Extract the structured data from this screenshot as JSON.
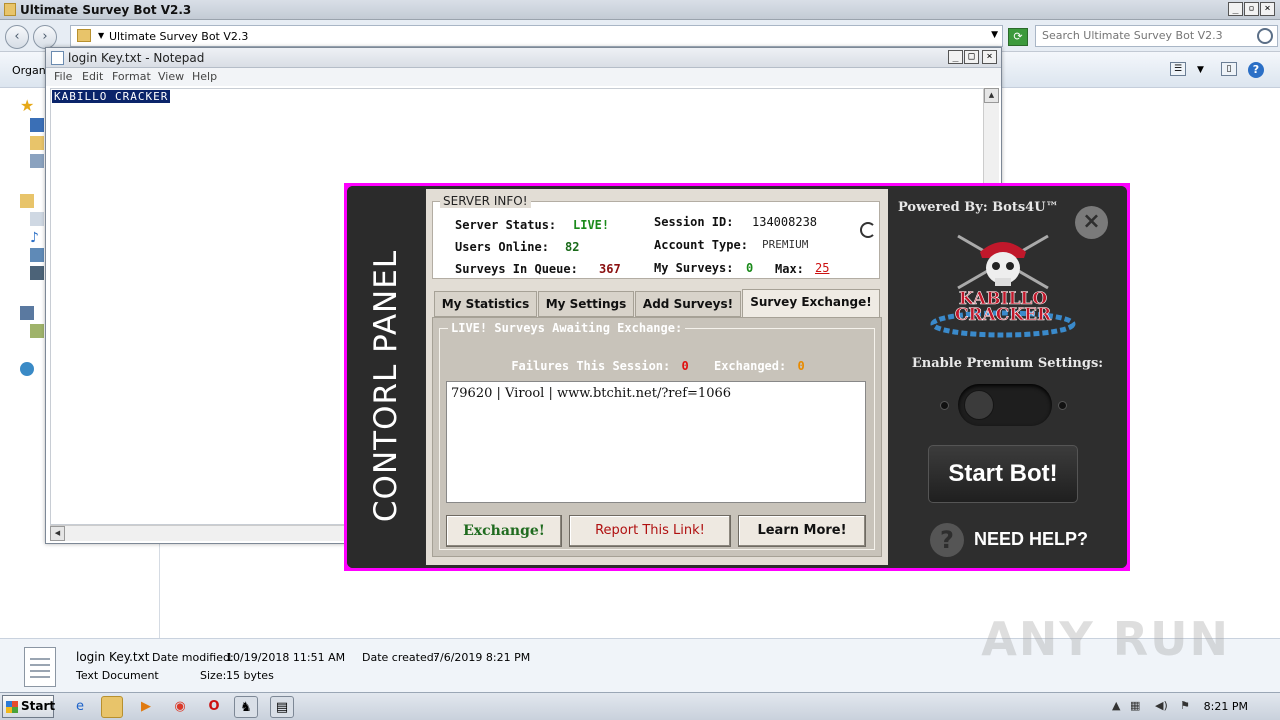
{
  "explorer": {
    "title": "Ultimate Survey Bot V2.3",
    "address": "Ultimate Survey Bot V2.3",
    "search_placeholder": "Search Ultimate Survey Bot V2.3",
    "organize_label": "Organi"
  },
  "file_details": {
    "name": "login Key.txt",
    "type": "Text Document",
    "date_modified_label": "Date modified:",
    "date_modified": "10/19/2018 11:51 AM",
    "date_created_label": "Date created:",
    "date_created": "7/6/2019 8:21 PM",
    "size_label": "Size:",
    "size": "15 bytes"
  },
  "notepad": {
    "title": "login Key.txt - Notepad",
    "menu": [
      "File",
      "Edit",
      "Format",
      "View",
      "Help"
    ],
    "content": "KABILLO CRACKER"
  },
  "bot": {
    "side_label": "CONTORL PANEL",
    "server": {
      "legend": "SERVER INFO!",
      "status_label": "Server Status:",
      "status_value": "LIVE!",
      "users_label": "Users Online:",
      "users_value": "82",
      "queue_label": "Surveys In Queue:",
      "queue_value": "367",
      "session_label": "Session ID:",
      "session_value": "134008238",
      "account_label": "Account Type:",
      "account_value": "PREMIUM",
      "mysurveys_label": "My Surveys:",
      "mysurveys_value": "0",
      "max_label": "Max:",
      "max_value": "25"
    },
    "tabs": [
      "My Statistics",
      "My Settings",
      "Add Surveys!",
      "Survey Exchange!"
    ],
    "exchange": {
      "legend": "LIVE! Surveys Awaiting Exchange:",
      "failures_label": "Failures This Session:",
      "failures_value": "0",
      "exchanged_label": "Exchanged:",
      "exchanged_value": "0",
      "list_item": "79620 | Virool | www.btchit.net/?ref=1066",
      "buttons": {
        "exchange": "Exchange!",
        "report": "Report This Link!",
        "learn": "Learn More!"
      }
    },
    "right": {
      "powered": "Powered By: Bots4U™",
      "close": "×",
      "logo_line1": "KABILLO",
      "logo_line2": "CRACKER",
      "enable_label": "Enable Premium Settings:",
      "start_button": "Start Bot!",
      "help_label": "NEED HELP?",
      "help_icon": "?"
    }
  },
  "taskbar": {
    "start_label": "Start",
    "clock": "8:21 PM"
  },
  "watermark": "ANY RUN",
  "colors": {
    "live": "#1a8a1a",
    "max_red": "#cc1111",
    "failures": "#e01010",
    "exchanged": "#e88a00",
    "exchange_btn": "#1f6b1f",
    "report_btn": "#b01010",
    "bot_border": "#ff00ff"
  }
}
